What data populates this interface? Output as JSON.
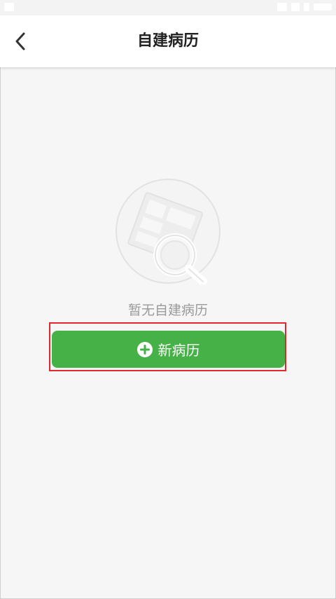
{
  "header": {
    "title": "自建病历"
  },
  "empty_state": {
    "message": "暂无自建病历"
  },
  "actions": {
    "new_record_label": "新病历"
  },
  "icons": {
    "back": "chevron-left-icon",
    "illustration": "document-search-icon",
    "add": "plus-circle-icon"
  },
  "colors": {
    "accent": "#45b146",
    "highlight": "#e0282e",
    "background": "#f6f6f6"
  }
}
